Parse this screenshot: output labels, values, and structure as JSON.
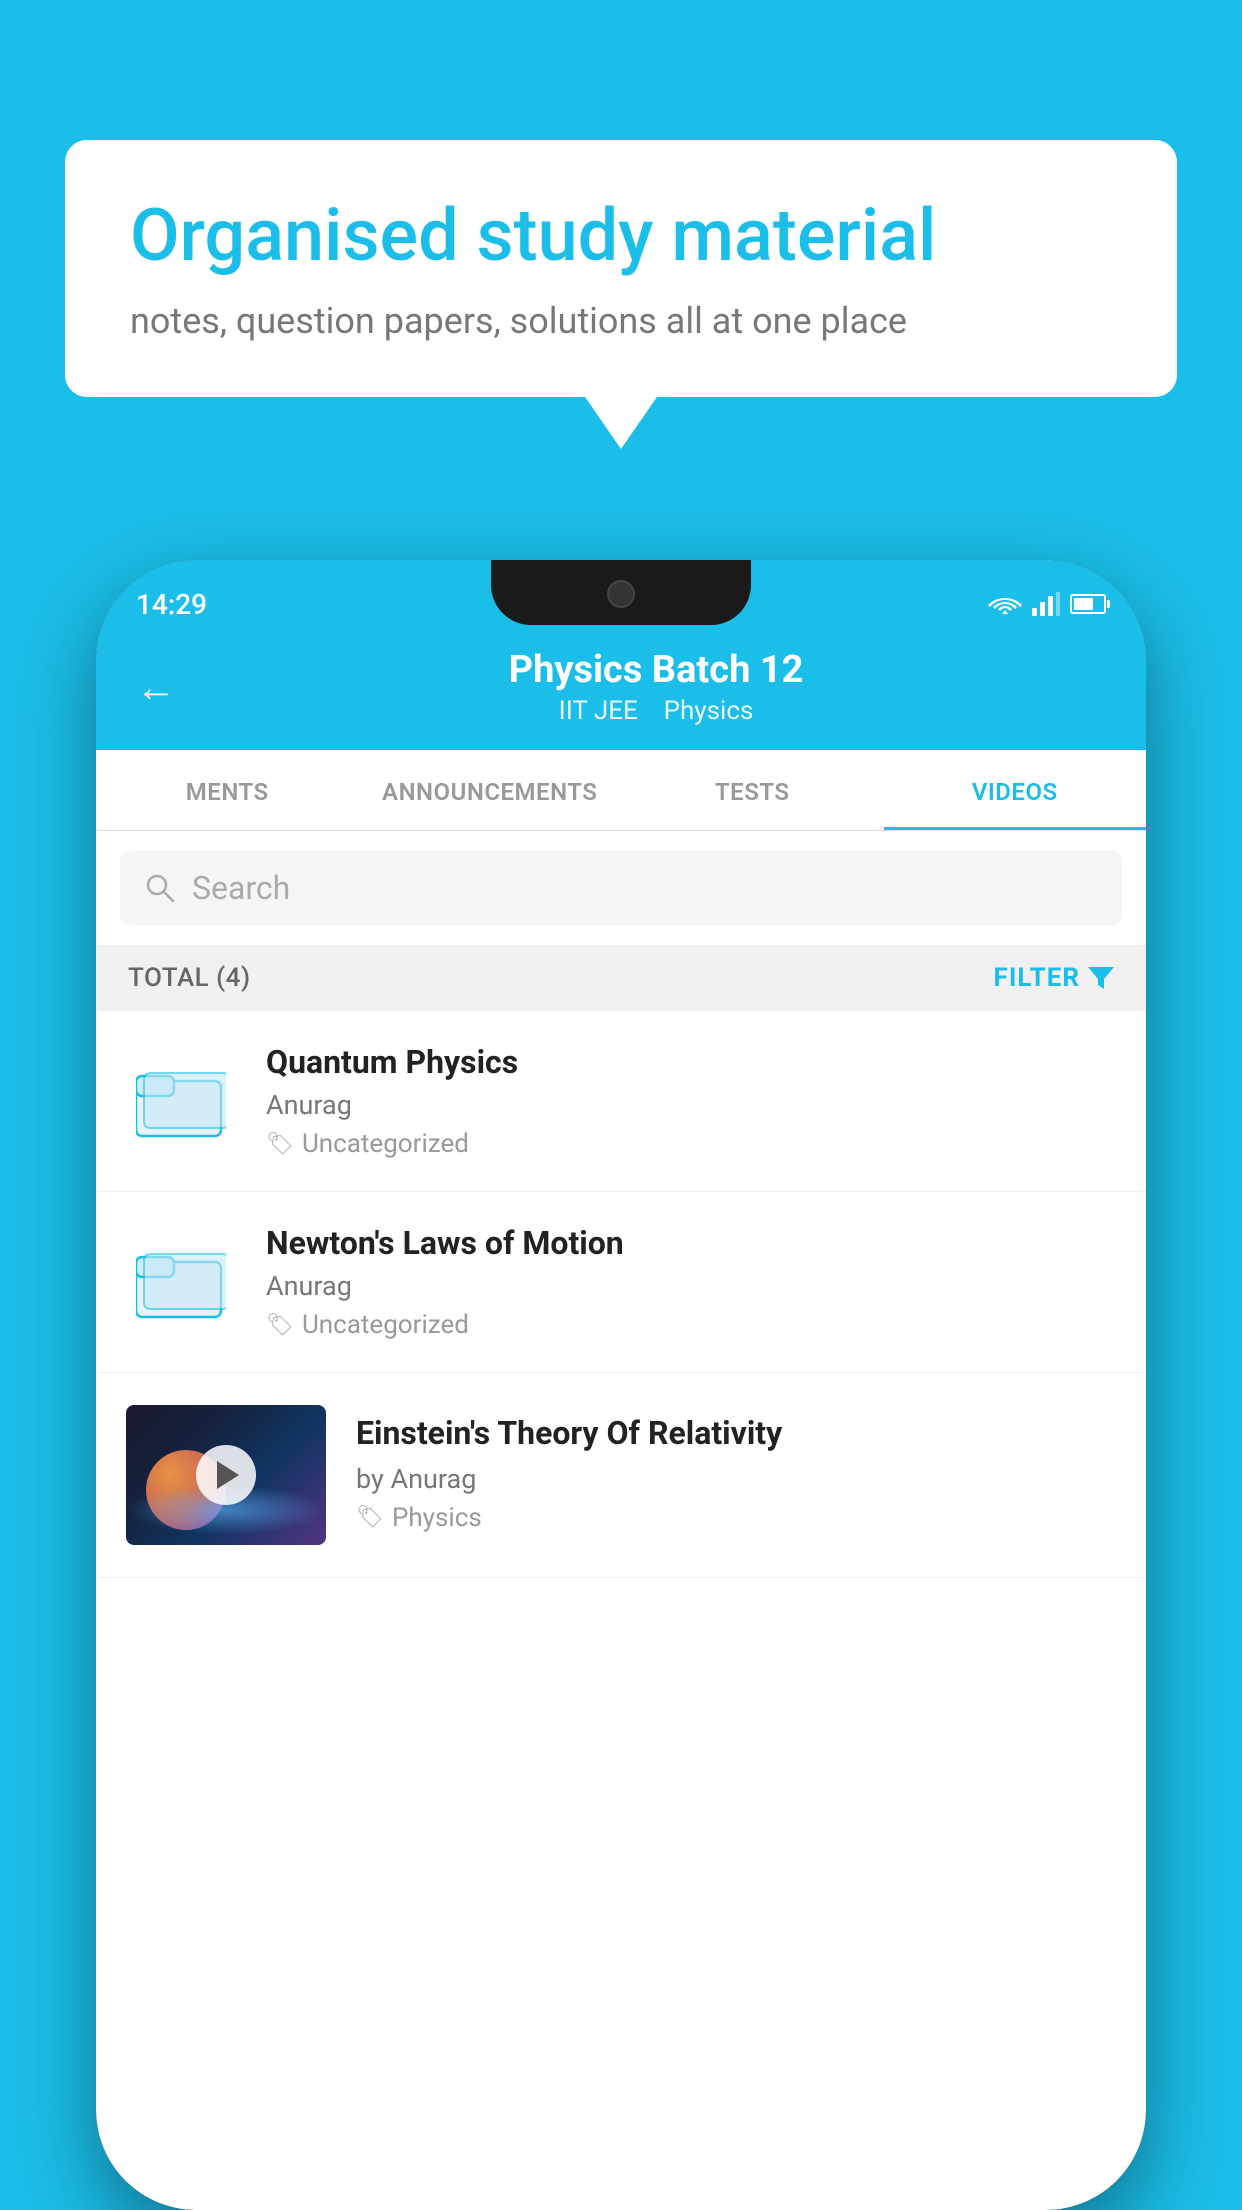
{
  "background": {
    "color": "#1BBEE8"
  },
  "speech_bubble": {
    "title": "Organised study material",
    "subtitle": "notes, question papers, solutions all at one place"
  },
  "status_bar": {
    "time": "14:29",
    "wifi": "wifi",
    "signal": "signal",
    "battery": "battery"
  },
  "header": {
    "back_label": "←",
    "title": "Physics Batch 12",
    "subtitle_tag1": "IIT JEE",
    "subtitle_tag2": "Physics"
  },
  "tabs": [
    {
      "label": "MENTS",
      "active": false
    },
    {
      "label": "ANNOUNCEMENTS",
      "active": false
    },
    {
      "label": "TESTS",
      "active": false
    },
    {
      "label": "VIDEOS",
      "active": true
    }
  ],
  "search": {
    "placeholder": "Search"
  },
  "filter_bar": {
    "total_label": "TOTAL (4)",
    "filter_label": "FILTER"
  },
  "videos": [
    {
      "title": "Quantum Physics",
      "author": "Anurag",
      "tag": "Uncategorized",
      "type": "folder"
    },
    {
      "title": "Newton's Laws of Motion",
      "author": "Anurag",
      "tag": "Uncategorized",
      "type": "folder"
    },
    {
      "title": "Einstein's Theory Of Relativity",
      "author": "by Anurag",
      "tag": "Physics",
      "type": "video"
    }
  ]
}
